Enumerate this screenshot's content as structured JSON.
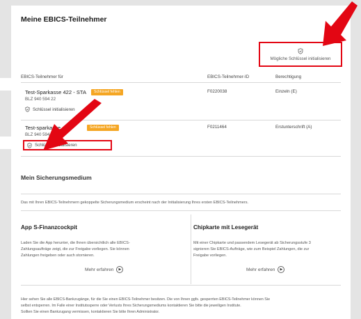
{
  "page": {
    "title": "Meine EBICS-Teilnehmer",
    "init_all_label": "Mögliche Schlüssel initialisieren"
  },
  "table": {
    "headers": [
      "EBICS-Teilnehmer für",
      "EBICS-Teilnehmer-ID",
      "Berechtigung"
    ],
    "rows": [
      {
        "name": "Test-Sparkasse 422 - STA",
        "badge": "Schlüssel fehlen",
        "blz": "BLZ 940 594 22",
        "id": "F0220038",
        "permission": "Einzeln (E)",
        "action": "Schlüssel initialisieren"
      },
      {
        "name": "Test-sparkasse 421",
        "badge": "Schlüssel fehlen",
        "blz": "BLZ 940 594 21",
        "id": "F0211464",
        "permission": "Erstunterschrift (A)",
        "action": "Schlüssel initialisieren"
      }
    ]
  },
  "security": {
    "title": "Mein Sicherungsmedium",
    "description": "Das mit Ihren EBICS-Teilnehmern gekoppelte Sicherungsmedium erscheint nach der Initialisierung Ihres ersten EBICS-Teilnehmers.",
    "options": [
      {
        "title": "App S-Finanzcockpit",
        "text_lines": [
          "Laden Sie die App herunter, die Ihnen übersichtlich alle EBICS-",
          "Zahlungsaufträge zeigt, die zur Freigabe vorliegen. Sie können",
          "Zahlungen freigeben oder auch stornieren."
        ],
        "more": "Mehr erfahren"
      },
      {
        "title": "Chipkarte mit Lesegerät",
        "text_lines": [
          "Mit einer Chipkarte und passendem Lesegerät ab Sicherungsstufe 3",
          "signieren Sie EBICS-Aufträge, wie zum Beispiel Zahlungen, die zur",
          "Freigabe vorliegen."
        ],
        "more": "Mehr erfahren"
      }
    ]
  },
  "footer": {
    "lines": [
      "Hier sehen Sie alle EBICS-Bankzugänge, für die Sie einen EBICS-Teilnehmer besitzen. Die von Ihnen ggfs. gesperrten EBICS-Teilnehmer können Sie",
      "selbst entsperren. Im Falle einer Institutssperre oder Verlusts Ihres Sicherungsmediums kontaktieren Sie bitte die jeweiligen Institute.",
      "Sollten Sie einen Bankzugang vermissen, kontaktieren Sie bitte Ihren Administrator."
    ]
  },
  "colors": {
    "accent_red": "#e30613",
    "badge_orange": "#f5a623"
  },
  "icons": {
    "shield": "shield-icon",
    "more": "circle-arrow-right-icon",
    "annotation": "red-arrow-icon"
  }
}
